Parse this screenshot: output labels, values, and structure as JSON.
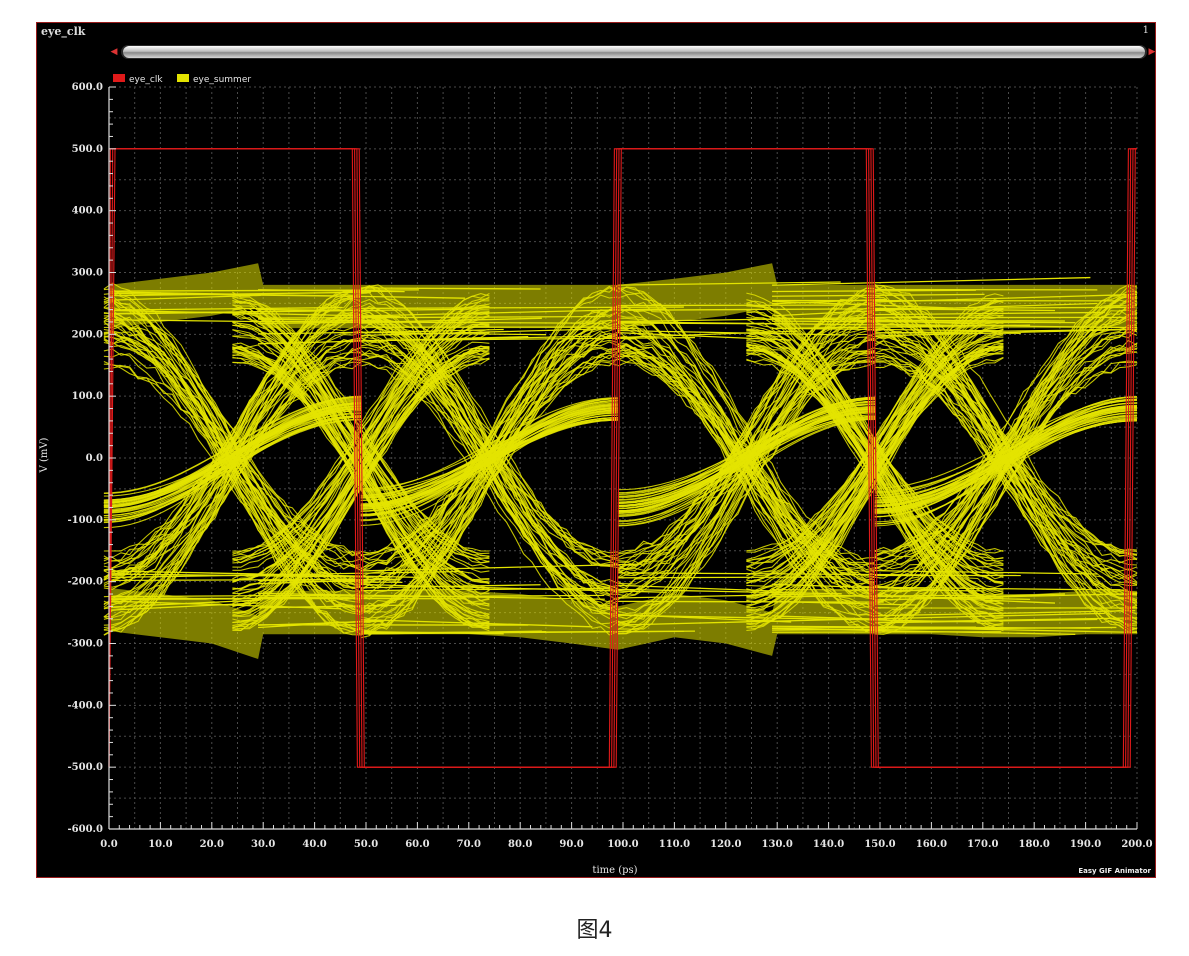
{
  "window": {
    "title": "eye_clk",
    "page_number": "1",
    "watermark": "Easy GIF Animator"
  },
  "caption": "图4",
  "colors": {
    "background": "#000000",
    "grid": "#4a4a4a",
    "eye_clk": "#e01a1a",
    "eye_summer": "#e4e400",
    "text": "#e6e6e6"
  },
  "chart_data": {
    "type": "line",
    "title": "",
    "xlabel": "time (ps)",
    "ylabel": "V (mV)",
    "xlim": [
      0,
      200
    ],
    "ylim": [
      -600,
      600
    ],
    "x_ticks": [
      0,
      10,
      20,
      30,
      40,
      50,
      60,
      70,
      80,
      90,
      100,
      110,
      120,
      130,
      140,
      150,
      160,
      170,
      180,
      190,
      200
    ],
    "x_tick_labels": [
      "0.0",
      "10.0",
      "20.0",
      "30.0",
      "40.0",
      "50.0",
      "60.0",
      "70.0",
      "80.0",
      "90.0",
      "100.0",
      "110.0",
      "120.0",
      "130.0",
      "140.0",
      "150.0",
      "160.0",
      "170.0",
      "180.0",
      "190.0",
      "200.0"
    ],
    "y_ticks": [
      600,
      500,
      400,
      300,
      200,
      100,
      0,
      -100,
      -200,
      -300,
      -400,
      -500,
      -600
    ],
    "y_tick_labels": [
      "600.0",
      "500.0",
      "400.0",
      "300.0",
      "200.0",
      "100.0",
      "0.0",
      "-100.0",
      "-200.0",
      "-300.0",
      "-400.0",
      "-500.0",
      "-600.0"
    ],
    "grid": true,
    "legend_position": "top-left",
    "series": [
      {
        "name": "eye_clk",
        "color": "#e01a1a",
        "x": [
          0,
          0.5,
          1,
          48,
          49,
          50,
          98,
          99,
          100,
          148,
          149,
          150,
          198,
          199,
          200
        ],
        "y": [
          -500,
          500,
          500,
          500,
          -500,
          -500,
          -500,
          500,
          500,
          500,
          -500,
          -500,
          -500,
          500,
          500
        ]
      },
      {
        "name": "eye_summer",
        "color": "#e4e400",
        "x": [
          0,
          10,
          20,
          29,
          30,
          40,
          49,
          60,
          70,
          80,
          90,
          99,
          110,
          120,
          129,
          130,
          140,
          149,
          160,
          170,
          180,
          190,
          200
        ],
        "y_max": [
          280,
          290,
          300,
          315,
          280,
          280,
          280,
          280,
          280,
          280,
          280,
          280,
          290,
          300,
          315,
          280,
          280,
          280,
          280,
          280,
          280,
          280,
          280
        ],
        "y_min": [
          -280,
          -290,
          -300,
          -325,
          -285,
          -285,
          -285,
          -285,
          -285,
          -290,
          -300,
          -310,
          -290,
          -300,
          -320,
          -285,
          -285,
          -285,
          -285,
          -290,
          -290,
          -285,
          -285
        ],
        "eye_crossings": [
          {
            "x": 49,
            "y": 0
          },
          {
            "x": 149,
            "y": 0
          }
        ],
        "eye_opening": {
          "center_x": 99,
          "top": 150,
          "bottom": -150
        }
      }
    ]
  }
}
